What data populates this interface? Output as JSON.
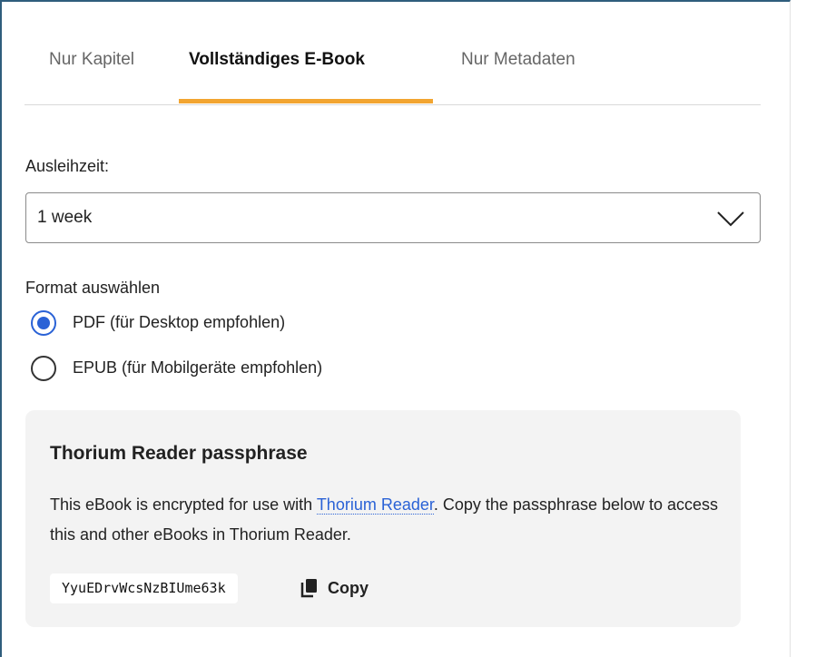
{
  "tabs": [
    {
      "label": "Nur Kapitel",
      "active": false
    },
    {
      "label": "Vollständiges E-Book",
      "active": true
    },
    {
      "label": "Nur Metadaten",
      "active": false
    }
  ],
  "loan": {
    "label": "Ausleihzeit:",
    "selected_value": "1 week"
  },
  "format": {
    "label": "Format auswählen",
    "options": [
      {
        "label": "PDF (für Desktop empfohlen)",
        "checked": true
      },
      {
        "label": "EPUB (für Mobilgeräte empfohlen)",
        "checked": false
      }
    ]
  },
  "passphrase_panel": {
    "title": "Thorium Reader passphrase",
    "text_before_link": "This eBook is encrypted for use with ",
    "link_text": "Thorium Reader",
    "text_after_link": ". Copy the passphrase below to access this and other eBooks in Thorium Reader.",
    "passphrase": "YyuEDrvWcsNzBIUme63k",
    "copy_label": "Copy"
  },
  "colors": {
    "accent_tab": "#f2a531",
    "radio_selected": "#2a62d6",
    "link": "#2a62d6",
    "panel_bg": "#f3f3f3"
  }
}
